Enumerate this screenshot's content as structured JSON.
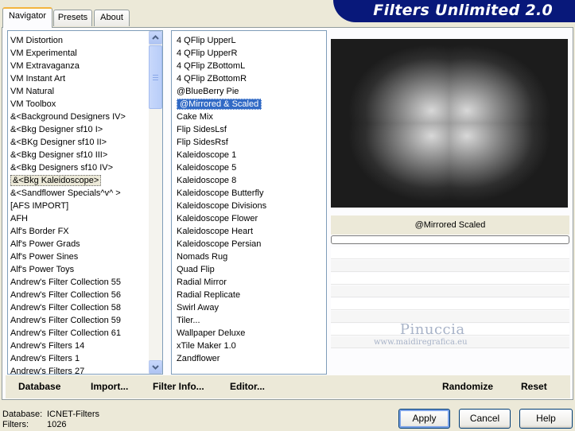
{
  "tabs": [
    {
      "label": "Navigator",
      "active": true
    },
    {
      "label": "Presets",
      "active": false
    },
    {
      "label": "About",
      "active": false
    }
  ],
  "banner": {
    "title": "Filters Unlimited 2.0",
    "color": "#08187a"
  },
  "categories": {
    "items": [
      "VM Distortion",
      "VM Experimental",
      "VM Extravaganza",
      "VM Instant Art",
      "VM Natural",
      "VM Toolbox",
      "&<Background Designers IV>",
      "&<Bkg Designer sf10 I>",
      "&<BKg Designer sf10 II>",
      "&<Bkg Designer sf10 III>",
      "&<Bkg Designers sf10 IV>",
      "&<Bkg Kaleidoscope>",
      "&<Sandflower Specials^v^ >",
      "[AFS IMPORT]",
      "AFH",
      "Alf's Border FX",
      "Alf's Power Grads",
      "Alf's Power Sines",
      "Alf's Power Toys",
      "Andrew's Filter Collection 55",
      "Andrew's Filter Collection 56",
      "Andrew's Filter Collection 58",
      "Andrew's Filter Collection 59",
      "Andrew's Filter Collection 61",
      "Andrew's Filters 14",
      "Andrew's Filters 1",
      "Andrew's Filters 27"
    ],
    "selected": "&<Bkg Kaleidoscope>"
  },
  "filters": {
    "items": [
      "4 QFlip UpperL",
      "4 QFlip UpperR",
      "4 QFlip ZBottomL",
      "4 QFlip ZBottomR",
      "@BlueBerry Pie",
      "@Mirrored & Scaled",
      "Cake Mix",
      "Flip SidesLsf",
      "Flip SidesRsf",
      "Kaleidoscope 1",
      "Kaleidoscope 5",
      "Kaleidoscope 8",
      "Kaleidoscope Butterfly",
      "Kaleidoscope Divisions",
      "Kaleidoscope Flower",
      "Kaleidoscope Heart",
      "Kaleidoscope Persian",
      "Nomads Rug",
      "Quad Flip",
      "Radial Mirror",
      "Radial Replicate",
      "Swirl Away",
      "Tiler...",
      "Wallpaper Deluxe",
      "xTile Maker 1.0",
      "Zandflower"
    ],
    "selected": "@Mirrored & Scaled"
  },
  "preview": {
    "filter_name": "@Mirrored  Scaled"
  },
  "bottom_bar": {
    "database": "Database",
    "import": "Import...",
    "filter_info": "Filter Info...",
    "editor": "Editor...",
    "randomize": "Randomize",
    "reset": "Reset"
  },
  "footer": {
    "database_label": "Database:",
    "database_value": "ICNET-Filters",
    "filters_label": "Filters:",
    "filters_value": "1026",
    "apply": "Apply",
    "cancel": "Cancel",
    "help": "Help"
  },
  "watermark": {
    "name": "Pinuccia",
    "url": "www.maidiregrafica.eu"
  },
  "colors": {
    "selection": "#316ac5",
    "background": "#ece9d8",
    "active_tab_accent": "#f3b43e"
  }
}
